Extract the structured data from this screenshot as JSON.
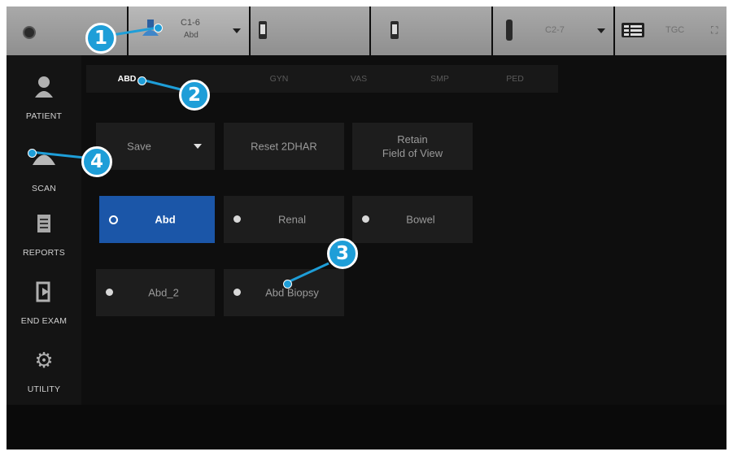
{
  "topbar": {
    "probe1": {
      "name": "C1-6",
      "preset": "Abd"
    },
    "probe4": {
      "name": "C2-7"
    },
    "tgc_label": "TGC"
  },
  "sidebar": {
    "items": [
      {
        "label": "PATIENT",
        "icon": "person-icon"
      },
      {
        "label": "SCAN",
        "icon": "scan-probe-icon"
      },
      {
        "label": "REPORTS",
        "icon": "reports-icon"
      },
      {
        "label": "END EXAM",
        "icon": "end-exam-icon"
      },
      {
        "label": "UTILITY",
        "icon": "gear-icon"
      }
    ]
  },
  "tabs": [
    "ABD",
    "GYN",
    "VAS",
    "SMP",
    "PED"
  ],
  "active_tab": "ABD",
  "actions": {
    "save": "Save",
    "reset": "Reset 2DHAR",
    "retain_line1": "Retain",
    "retain_line2": "Field of View"
  },
  "presets": [
    {
      "label": "Abd",
      "selected": true
    },
    {
      "label": "Renal",
      "selected": false
    },
    {
      "label": "Bowel",
      "selected": false
    },
    {
      "label": "Abd_2",
      "selected": false
    },
    {
      "label": "Abd Biopsy",
      "selected": false
    }
  ],
  "callouts": [
    "1",
    "2",
    "3",
    "4"
  ],
  "colors": {
    "accent": "#1e9ed8",
    "selected": "#1b56a8",
    "background": "#0e0e0e"
  }
}
